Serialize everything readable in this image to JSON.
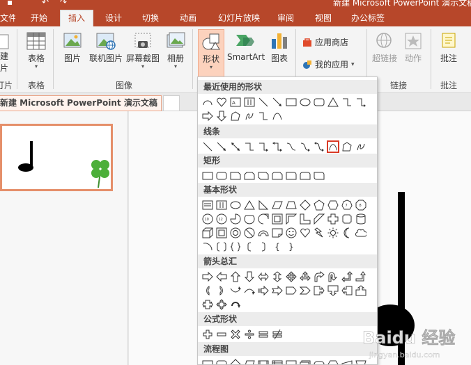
{
  "title_bar": {
    "doc_title": "新建 Microsoft PowerPoint 演示文稿"
  },
  "tabs": [
    {
      "label": "文件"
    },
    {
      "label": "开始"
    },
    {
      "label": "插入"
    },
    {
      "label": "设计"
    },
    {
      "label": "切换"
    },
    {
      "label": "动画"
    },
    {
      "label": "幻灯片放映"
    },
    {
      "label": "审阅"
    },
    {
      "label": "视图"
    },
    {
      "label": "办公标签"
    }
  ],
  "ribbon": {
    "new_slide": {
      "line1": "建",
      "line2": "片"
    },
    "table_label": "表格",
    "picture_label": "图片",
    "online_picture_label": "联机图片",
    "screenshot_label": "屏幕截图",
    "album_label": "相册",
    "shapes_label": "形状",
    "smartart_label": "SmartArt",
    "chart_label": "图表",
    "store_label": "应用商店",
    "my_apps_label": "我的应用",
    "hyperlink_label": "超链接",
    "action_label": "动作",
    "comment_label": "批注",
    "groups": {
      "slides": "灯片",
      "table": "表格",
      "images": "图像",
      "links": "链接",
      "comments": "批注"
    }
  },
  "doc_tab": {
    "label": "新建 Microsoft PowerPoint 演示文稿",
    "close": "×"
  },
  "dropdown": {
    "sections": {
      "recent": "最近使用的形状",
      "lines": "线条",
      "rectangles": "矩形",
      "basic": "基本形状",
      "arrows": "箭头总汇",
      "equation": "公式形状",
      "flowchart": "流程图"
    },
    "brace_left": "{",
    "brace_right": "}"
  },
  "colors": {
    "accent": "#b7472a",
    "selected_shape_border": "#d93a26",
    "shape_button_bg": "#fcd2bd"
  },
  "watermark": {
    "text": "Baidu 经验",
    "sub": "jingyan.baidu.com"
  }
}
